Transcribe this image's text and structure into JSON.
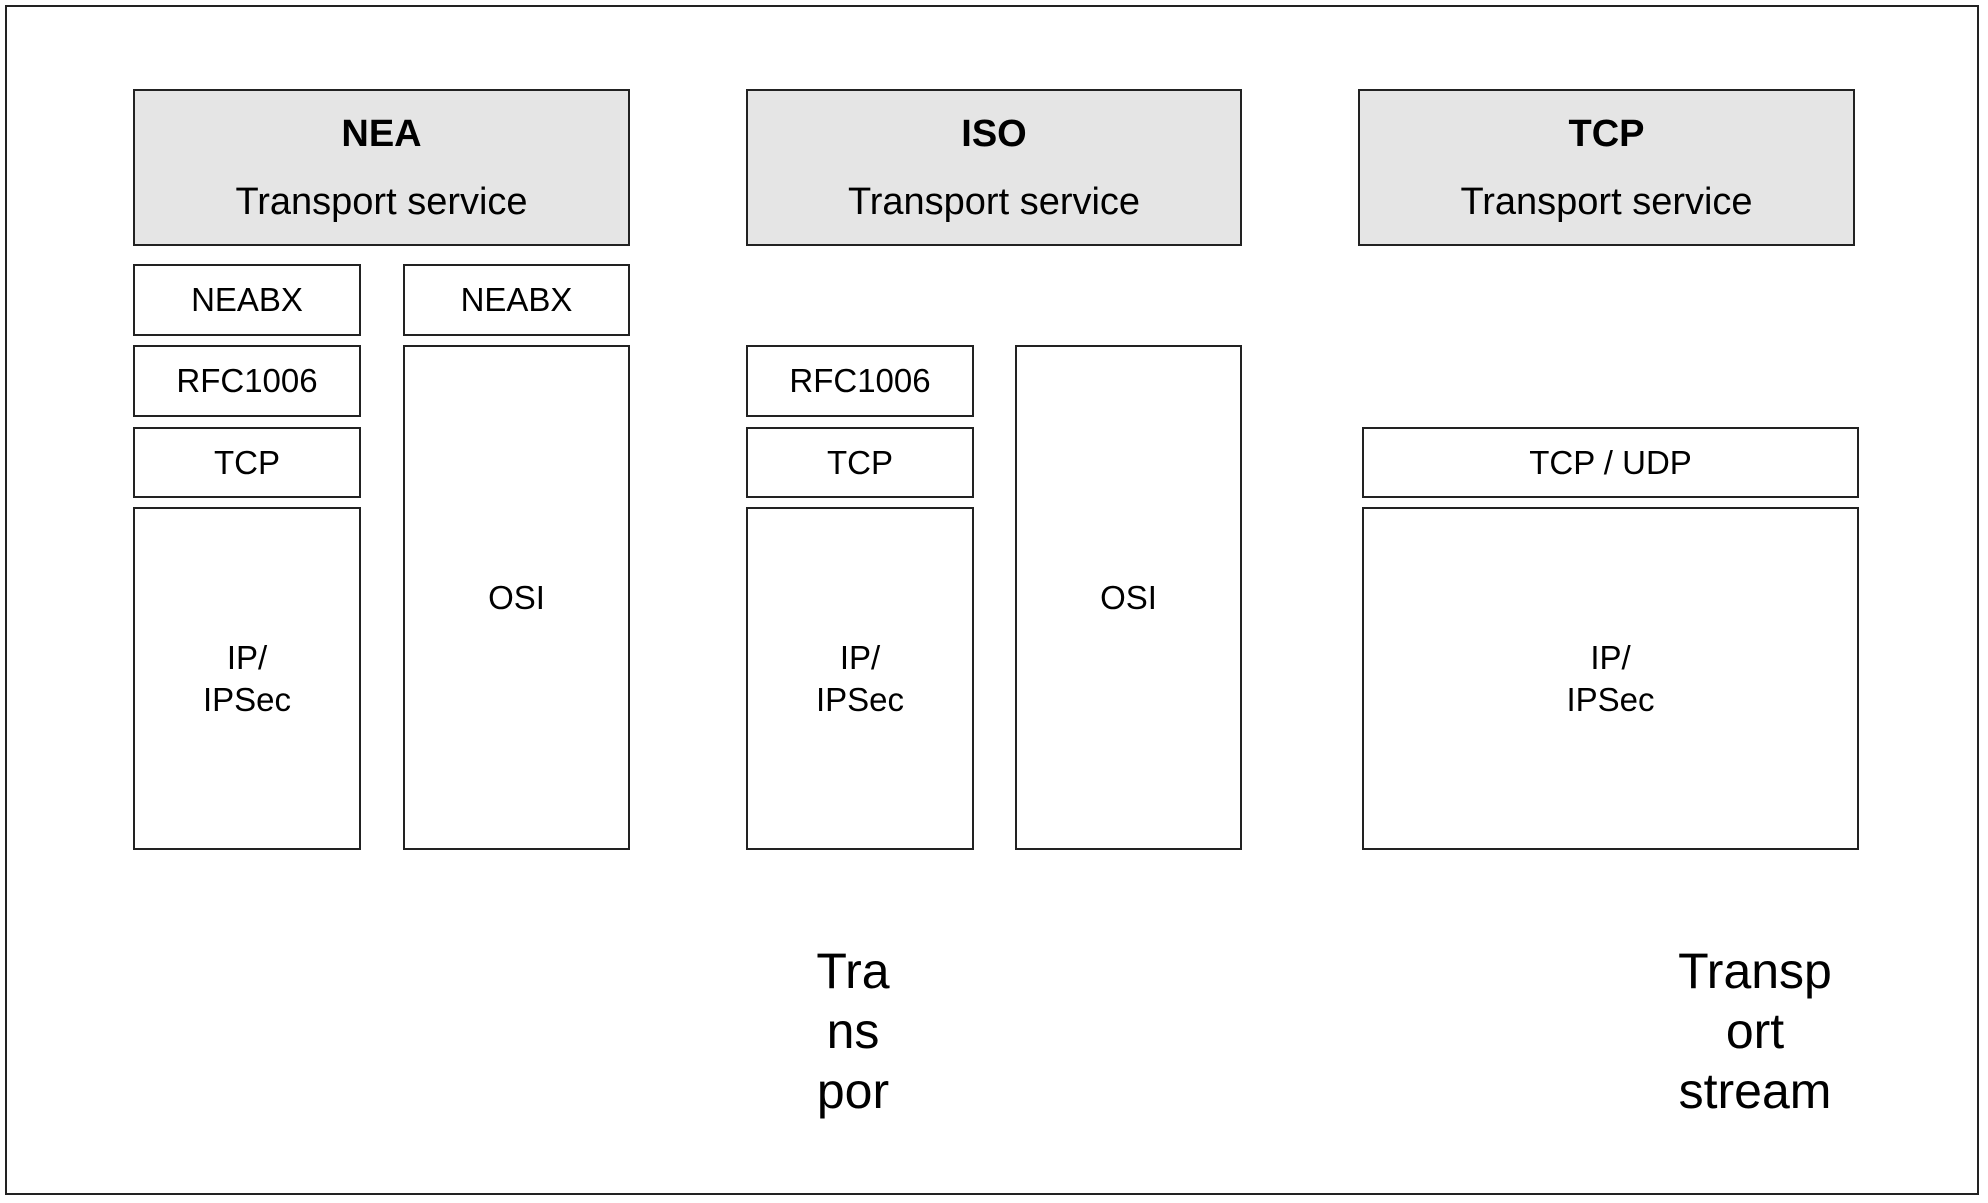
{
  "stacks": [
    {
      "name": "NEA",
      "service": "Transport service",
      "layers": {
        "neabx_left": "NEABX",
        "neabx_right": "NEABX",
        "rfc": "RFC1006",
        "tcp": "TCP",
        "ip": "IP/\nIPSec",
        "osi": "OSI"
      }
    },
    {
      "name": "ISO",
      "service": "Transport service",
      "layers": {
        "rfc": "RFC1006",
        "tcp": "TCP",
        "ip": "IP/\nIPSec",
        "osi": "OSI"
      },
      "caption": "Tra\nns\npor"
    },
    {
      "name": "TCP",
      "service": "Transport service",
      "layers": {
        "tcp_udp": "TCP / UDP",
        "ip": "IP/\nIPSec"
      },
      "caption": "Transp\nort\nstream"
    }
  ],
  "colors": {
    "header_fill": "#e5e5e5",
    "border": "#222222"
  }
}
